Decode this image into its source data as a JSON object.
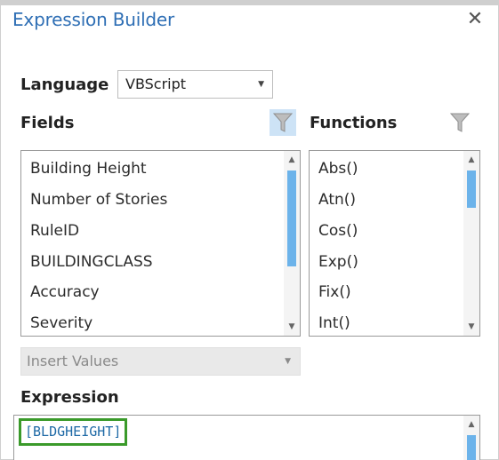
{
  "window": {
    "title": "Expression Builder",
    "close_symbol": "✕"
  },
  "language": {
    "label": "Language",
    "selected": "VBScript"
  },
  "fields": {
    "label": "Fields",
    "filter_icon": "filter-icon",
    "items": [
      "Building Height",
      "Number of Stories",
      "RuleID",
      "BUILDINGCLASS",
      "Accuracy",
      "Severity"
    ]
  },
  "functions": {
    "label": "Functions",
    "filter_icon": "filter-icon",
    "items": [
      "Abs()",
      "Atn()",
      "Cos()",
      "Exp()",
      "Fix()",
      "Int()"
    ]
  },
  "insert_values": {
    "label": "Insert Values"
  },
  "expression": {
    "label": "Expression",
    "value": "[BLDGHEIGHT]"
  },
  "colors": {
    "title": "#2f6fb5",
    "scroll_thumb": "#6cb3ea",
    "filter_active_bg": "#cde3f6",
    "highlight_border": "#3a9a2a",
    "expression_text": "#1f6aa6"
  }
}
